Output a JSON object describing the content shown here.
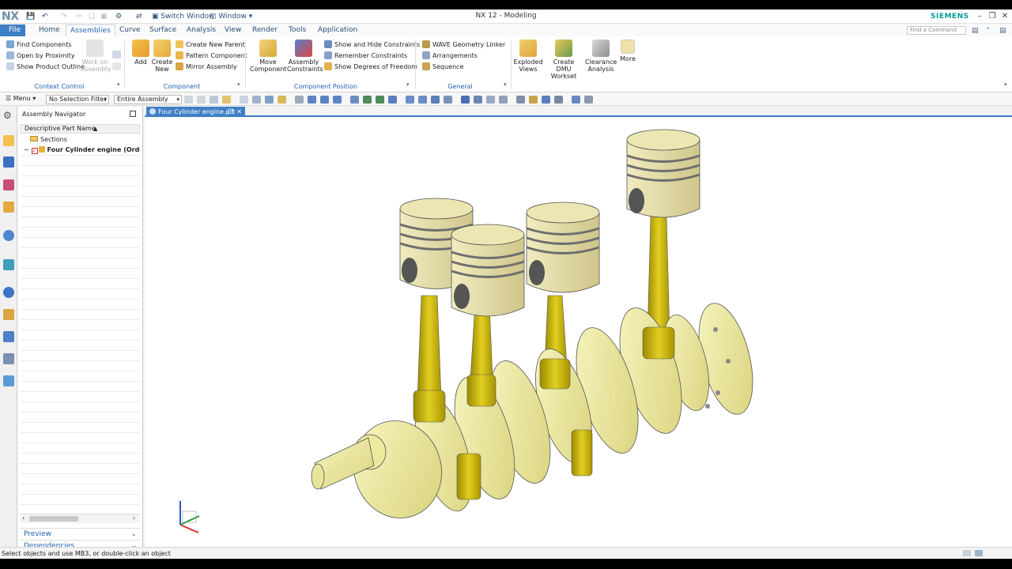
{
  "titlebar": {
    "logo": "NX",
    "title": "NX 12 - Modeling",
    "switch_window": "Switch Window",
    "window": "Window",
    "brand": "SIEMENS"
  },
  "tabs": [
    {
      "label": "File"
    },
    {
      "label": "Home"
    },
    {
      "label": "Assemblies"
    },
    {
      "label": "Curve"
    },
    {
      "label": "Surface"
    },
    {
      "label": "Analysis"
    },
    {
      "label": "View"
    },
    {
      "label": "Render"
    },
    {
      "label": "Tools"
    },
    {
      "label": "Application"
    }
  ],
  "command_finder": {
    "placeholder": "Find a Command"
  },
  "ribbon": {
    "context_control": {
      "label": "Context Control",
      "items": [
        "Find Components",
        "Open by Proximity",
        "Show Product Outline"
      ],
      "work_on_assembly": "Work on Assembly"
    },
    "component": {
      "label": "Component",
      "add": "Add",
      "create_new": "Create New",
      "items": [
        "Create New Parent",
        "Pattern Component",
        "Mirror Assembly"
      ]
    },
    "component_position": {
      "label": "Component Position",
      "move_component": "Move Component",
      "assembly_constraints": "Assembly Constraints",
      "items": [
        "Show and Hide Constraints",
        "Remember Constraints",
        "Show Degrees of Freedom"
      ]
    },
    "general": {
      "label": "General",
      "items": [
        "WAVE Geometry Linker",
        "Arrangements",
        "Sequence"
      ]
    },
    "exploded_views": "Exploded Views",
    "create_dmu_workset": "Create DMU Workset",
    "clearance_analysis": "Clearance Analysis",
    "more": "More"
  },
  "toolbar": {
    "menu": "Menu",
    "selection_filter": "No Selection Filter",
    "scope": "Entire Assembly"
  },
  "navigator": {
    "title": "Assembly Navigator",
    "column": "Descriptive Part Name",
    "rows": [
      "Sections",
      "Four Cylinder engine (Order: ..."
    ],
    "preview": "Preview",
    "dependencies": "Dependencies"
  },
  "document_tab": "Four Cylinder engine.prt",
  "status": "Select objects and use MB3, or double-click an object",
  "colors": {
    "accent": "#3f7fc6",
    "brand": "#009999",
    "piston": "#e6dfa6",
    "rod": "#c8b400",
    "crank": "#eeed9e"
  }
}
